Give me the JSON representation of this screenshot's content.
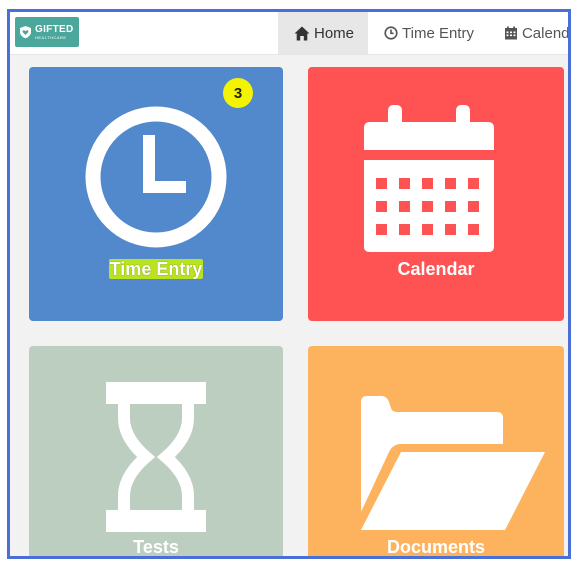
{
  "header": {
    "logo": {
      "name": "GIFTED",
      "sub": "HEALTHCARE"
    },
    "nav": [
      {
        "label": "Home",
        "icon": "home-icon",
        "active": true
      },
      {
        "label": "Time Entry",
        "icon": "clock-icon",
        "active": false
      },
      {
        "label": "Calenda",
        "icon": "calendar-icon",
        "active": false
      }
    ]
  },
  "tiles": [
    {
      "label": "Time Entry",
      "icon": "clock-icon",
      "color": "#5289cc",
      "badge": "3"
    },
    {
      "label": "Calendar",
      "icon": "calendar-icon",
      "color": "#ff5252"
    },
    {
      "label": "Tests",
      "icon": "hourglass-icon",
      "color": "#bccec0"
    },
    {
      "label": "Documents",
      "icon": "folder-icon",
      "color": "#fdb35d"
    }
  ],
  "colors": {
    "frame_border": "#4a6fd6",
    "brand": "#4ba79b",
    "badge": "#f4f400",
    "highlight": "#b8e31e"
  }
}
